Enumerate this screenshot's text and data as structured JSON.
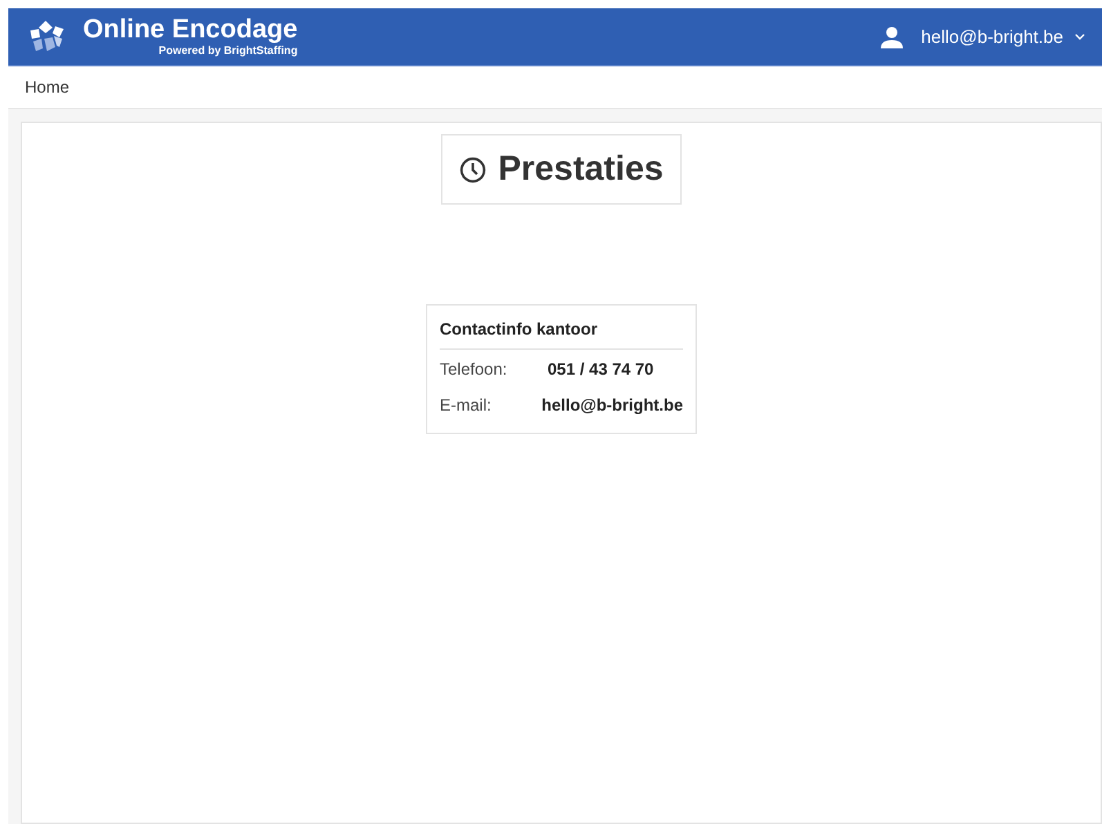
{
  "header": {
    "title": "Online Encodage",
    "subtitle": "Powered by BrightStaffing",
    "user": "hello@b-bright.be"
  },
  "breadcrumb": [
    "Home"
  ],
  "page_title": "Prestaties",
  "contact": {
    "title": "Contactinfo kantoor",
    "rows": [
      {
        "label": "Telefoon:",
        "value": "051 / 43 74 70"
      },
      {
        "label": "E-mail:",
        "value": "hello@b-bright.be"
      }
    ]
  }
}
